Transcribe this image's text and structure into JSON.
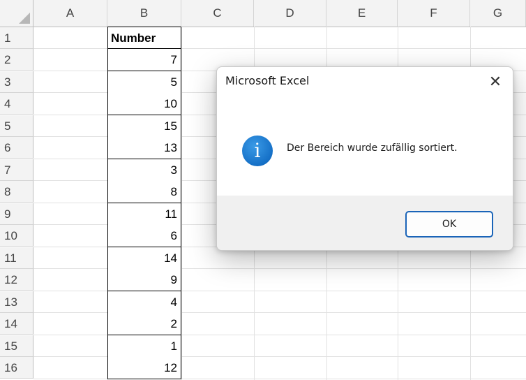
{
  "columns": [
    "A",
    "B",
    "C",
    "D",
    "E",
    "F",
    "G"
  ],
  "rows": [
    "1",
    "2",
    "3",
    "4",
    "5",
    "6",
    "7",
    "8",
    "9",
    "10",
    "11",
    "12",
    "13",
    "14",
    "15",
    "16"
  ],
  "table": {
    "header": "Number",
    "values": [
      "7",
      "5",
      "10",
      "15",
      "13",
      "3",
      "8",
      "11",
      "6",
      "14",
      "9",
      "4",
      "2",
      "1",
      "12"
    ]
  },
  "dialog": {
    "title": "Microsoft Excel",
    "close_glyph": "✕",
    "icon": "info-icon",
    "icon_glyph": "i",
    "message": "Der Bereich wurde zufällig sortiert.",
    "ok_label": "OK"
  }
}
